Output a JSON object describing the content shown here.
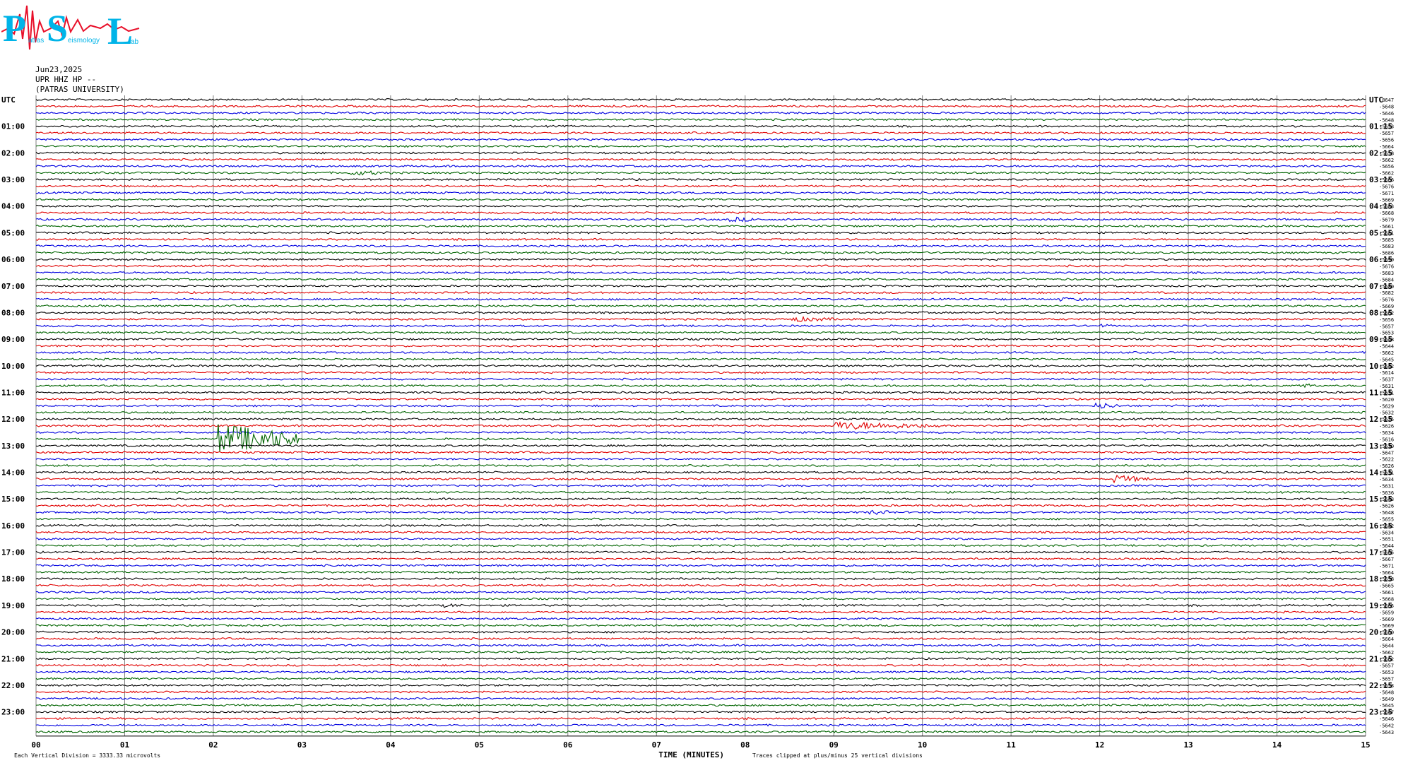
{
  "logo": {
    "letters": [
      "P",
      "S",
      "L"
    ],
    "small_words": [
      "atras",
      "eismology",
      "ab"
    ]
  },
  "header": {
    "date": "Jun23,2025",
    "station": "UPR HHZ HP --",
    "institution": "(PATRAS UNIVERSITY)"
  },
  "colors": {
    "trace_cycle": [
      "#000000",
      "#e00000",
      "#0000e0",
      "#006400"
    ],
    "grid": "#808080",
    "logo_blue": "#00b4e8",
    "logo_red": "#e8102a"
  },
  "chart_data": {
    "type": "line",
    "title": "",
    "xlabel": "TIME (MINUTES)",
    "ylabel": "UTC",
    "x_ticks": [
      "00",
      "01",
      "02",
      "03",
      "04",
      "05",
      "06",
      "07",
      "08",
      "09",
      "10",
      "11",
      "12",
      "13",
      "14",
      "15"
    ],
    "xlim": [
      0,
      15
    ],
    "grid": true,
    "traces_per_hour": 4,
    "trace_count": 96,
    "left_hour_labels": [
      "UTC",
      "01:00",
      "02:00",
      "03:00",
      "04:00",
      "05:00",
      "06:00",
      "07:00",
      "08:00",
      "09:00",
      "10:00",
      "11:00",
      "12:00",
      "13:00",
      "14:00",
      "15:00",
      "16:00",
      "17:00",
      "18:00",
      "19:00",
      "20:00",
      "21:00",
      "22:00",
      "23:00"
    ],
    "right_hour_labels": [
      "UTC",
      "01:15",
      "02:15",
      "03:15",
      "04:15",
      "05:15",
      "06:15",
      "07:15",
      "08:15",
      "09:15",
      "10:15",
      "11:15",
      "12:15",
      "13:15",
      "14:15",
      "15:15",
      "16:15",
      "17:15",
      "18:15",
      "19:15",
      "20:15",
      "21:15",
      "22:15",
      "23:15"
    ],
    "trace_offsets": [
      "-8647",
      "-5648",
      "-5646",
      "-5648",
      "-5653",
      "-5657",
      "-5656",
      "-5664",
      "-5658",
      "-5662",
      "-5656",
      "-5662",
      "-5666",
      "-5676",
      "-5671",
      "-5669",
      "-5683",
      "-5668",
      "-5679",
      "-5661",
      "-5681",
      "-5685",
      "-5683",
      "-5686",
      "-5690",
      "-5676",
      "-5683",
      "-5684",
      "-5680",
      "-5682",
      "-5676",
      "-5669",
      "-5662",
      "-5656",
      "-5657",
      "-5653",
      "-5648",
      "-5644",
      "-5662",
      "-5645",
      "-5642",
      "-5614",
      "-5637",
      "-5631",
      "-5631",
      "-5620",
      "-5629",
      "-5632",
      "-5625",
      "-5626",
      "-5634",
      "-5616",
      "-5630",
      "-5647",
      "-5622",
      "-5626",
      "-5631",
      "-5634",
      "-5631",
      "-5636",
      "-5643",
      "-5626",
      "-5648",
      "-5655",
      "-5642",
      "-5634",
      "-5651",
      "-5644",
      "-5665",
      "-5667",
      "-5671",
      "-5664",
      "-5658",
      "-5665",
      "-5661",
      "-5668",
      "-5665",
      "-5659",
      "-5669",
      "-5669",
      "-5660",
      "-5664",
      "-5644",
      "-5662",
      "-5662",
      "-5657",
      "-5653",
      "-5657",
      "-5653",
      "-5648",
      "-5649",
      "-5645",
      "-5647",
      "-5646",
      "-5642",
      "-5643"
    ],
    "events": [
      {
        "trace": 51,
        "minute": 2.05,
        "duration": 0.9,
        "amplitude": 22
      },
      {
        "trace": 49,
        "minute": 9.0,
        "duration": 1.2,
        "amplitude": 6
      },
      {
        "trace": 57,
        "minute": 12.15,
        "duration": 0.4,
        "amplitude": 6
      },
      {
        "trace": 11,
        "minute": 3.55,
        "duration": 0.5,
        "amplitude": 4
      },
      {
        "trace": 33,
        "minute": 8.5,
        "duration": 0.6,
        "amplitude": 4
      },
      {
        "trace": 18,
        "minute": 7.8,
        "duration": 0.4,
        "amplitude": 4
      },
      {
        "trace": 46,
        "minute": 11.95,
        "duration": 0.3,
        "amplitude": 5
      },
      {
        "trace": 43,
        "minute": 14.2,
        "duration": 0.3,
        "amplitude": 4
      },
      {
        "trace": 62,
        "minute": 9.4,
        "duration": 0.3,
        "amplitude": 4
      },
      {
        "trace": 76,
        "minute": 4.6,
        "duration": 0.3,
        "amplitude": 3
      },
      {
        "trace": 34,
        "minute": 12.0,
        "duration": 0.2,
        "amplitude": 3
      },
      {
        "trace": 30,
        "minute": 11.55,
        "duration": 0.4,
        "amplitude": 3
      }
    ],
    "footer_left": "Each Vertical Division = 3333.33 microvolts",
    "footer_right": "Traces clipped at plus/minus 25 vertical divisions"
  }
}
